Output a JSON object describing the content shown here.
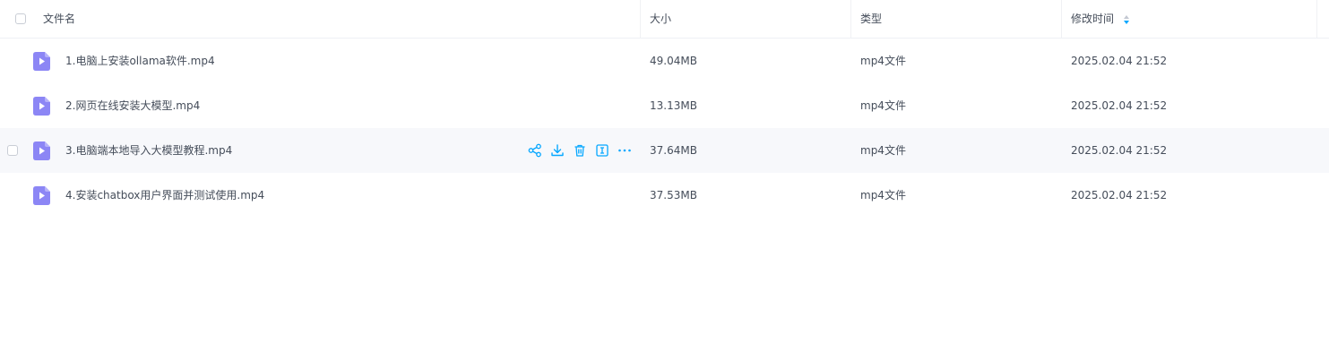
{
  "header": {
    "name_label": "文件名",
    "size_label": "大小",
    "type_label": "类型",
    "modified_label": "修改时间"
  },
  "files": [
    {
      "name": "1.电脑上安装ollama软件.mp4",
      "size": "49.04MB",
      "type": "mp4文件",
      "modified": "2025.02.04 21:52"
    },
    {
      "name": "2.网页在线安装大模型.mp4",
      "size": "13.13MB",
      "type": "mp4文件",
      "modified": "2025.02.04 21:52"
    },
    {
      "name": "3.电脑端本地导入大模型教程.mp4",
      "size": "37.64MB",
      "type": "mp4文件",
      "modified": "2025.02.04 21:52"
    },
    {
      "name": "4.安装chatbox用户界面并测试使用.mp4",
      "size": "37.53MB",
      "type": "mp4文件",
      "modified": "2025.02.04 21:52"
    }
  ],
  "colors": {
    "accent": "#06a7ff",
    "video_icon": "#8c86f5",
    "hover_row": "#f7f8fb"
  },
  "icons": {
    "row_actions": [
      "share-icon",
      "download-icon",
      "delete-icon",
      "rename-icon",
      "more-icon"
    ],
    "file": "video-file-icon",
    "sort": "sort-icon"
  }
}
